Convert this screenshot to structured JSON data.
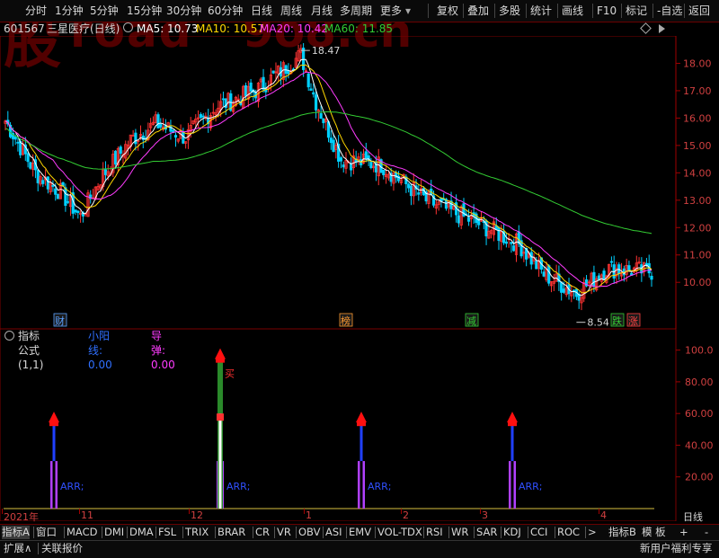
{
  "toolbar": {
    "left": [
      "分时",
      "1分钟",
      "5分钟",
      "15分钟",
      "30分钟",
      "60分钟",
      "日线",
      "周线",
      "月线",
      "多周期",
      "更多"
    ],
    "more_arrow": "▾",
    "right": [
      "复权",
      "叠加",
      "多股",
      "统计",
      "画线",
      "F10",
      "标记",
      "-自选",
      "返回"
    ]
  },
  "watermark": {
    "text": "股road  9o8.cn",
    "text_left": "股",
    "text_road": "road",
    "text_right": "9o8.cn"
  },
  "stock": {
    "code": "601567",
    "name": "三星医疗",
    "period": "(日线)"
  },
  "ma": [
    {
      "label": "MA5:",
      "value": "10.73",
      "color": "#ffffff"
    },
    {
      "label": "MA10:",
      "value": "10.57",
      "color": "#ffd700"
    },
    {
      "label": "MA20:",
      "value": "10.42",
      "color": "#ff3cff"
    },
    {
      "label": "MA60:",
      "value": "11.85",
      "color": "#33cc33"
    }
  ],
  "price_axis": [
    "18.00",
    "17.00",
    "16.00",
    "15.00",
    "14.00",
    "13.00",
    "12.00",
    "11.00",
    "10.00"
  ],
  "annotations": {
    "high": "18.47",
    "low": "8.54"
  },
  "event_tags": [
    {
      "text": "财",
      "color": "#5aa0ff"
    },
    {
      "text": "榜",
      "color": "#ff9a30"
    },
    {
      "text": "减",
      "color": "#33cc33"
    },
    {
      "text": "跌",
      "color": "#33cc33"
    },
    {
      "text": "涨",
      "color": "#ff4040"
    }
  ],
  "indicator": {
    "name": "指标公式(1,1)",
    "params": [
      {
        "label": "小阳线:",
        "value": "0.00",
        "color": "#3070ff"
      },
      {
        "label": "导弹:",
        "value": "0.00",
        "color": "#ff3cff"
      }
    ],
    "axis": [
      "100.0",
      "80.00",
      "60.00",
      "40.00",
      "20.00"
    ],
    "signal_label": "ARR;",
    "buy_label": "买",
    "signals": [
      {
        "value": 60
      },
      {
        "value": 100,
        "buy": true
      },
      {
        "value": 60
      },
      {
        "value": 60
      }
    ]
  },
  "time_axis": {
    "labels": [
      "2021年",
      "11",
      "12",
      "1",
      "2",
      "3",
      "4"
    ],
    "period": "日线"
  },
  "tabs": [
    "指标A",
    "窗口",
    "MACD",
    "DMI",
    "DMA",
    "FSL",
    "TRIX",
    "BRAR",
    "CR",
    "VR",
    "OBV",
    "ASI",
    "EMV",
    "VOL-TDX",
    "RSI",
    "WR",
    "SAR",
    "KDJ",
    "CCI",
    "ROC"
  ],
  "tabs_more": ">",
  "tabs_right": [
    "指标B",
    "模 板",
    "+",
    "-"
  ],
  "footer": {
    "expand": "扩展∧",
    "related": "关联报价",
    "promo": "新用户福利专享"
  },
  "chart_data": {
    "type": "candlestick",
    "price_range": [
      8.3,
      19.0
    ],
    "high": 18.47,
    "low": 8.54,
    "ma_last": {
      "MA5": 10.73,
      "MA10": 10.57,
      "MA20": 10.42,
      "MA60": 11.85
    },
    "indicator_range": [
      0,
      110
    ],
    "indicator_signals": [
      60,
      100,
      60,
      60
    ]
  }
}
